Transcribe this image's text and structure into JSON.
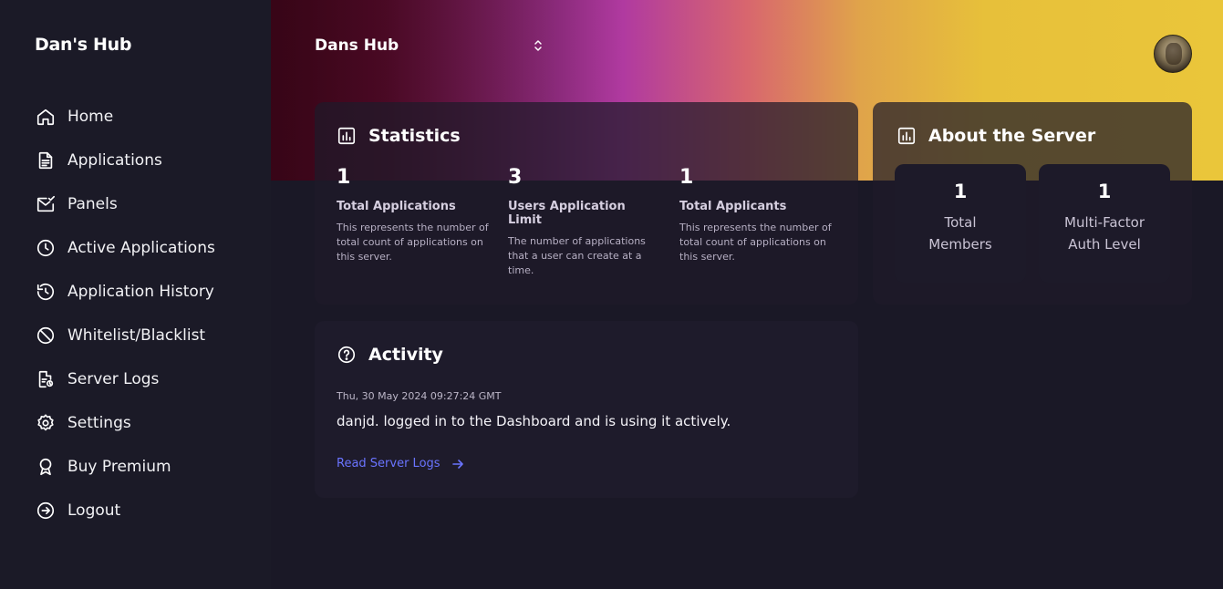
{
  "sidebar": {
    "brand": "Dan's Hub",
    "items": [
      {
        "label": "Home",
        "icon": "home-icon"
      },
      {
        "label": "Applications",
        "icon": "document-icon"
      },
      {
        "label": "Panels",
        "icon": "mail-check-icon"
      },
      {
        "label": "Active Applications",
        "icon": "clock-icon"
      },
      {
        "label": "Application History",
        "icon": "history-icon"
      },
      {
        "label": "Whitelist/Blacklist",
        "icon": "block-icon"
      },
      {
        "label": "Server Logs",
        "icon": "log-file-icon"
      },
      {
        "label": "Settings",
        "icon": "gear-icon"
      },
      {
        "label": "Buy Premium",
        "icon": "badge-icon"
      },
      {
        "label": "Logout",
        "icon": "logout-icon"
      }
    ]
  },
  "header": {
    "server_name": "Dans Hub",
    "switch_icon": "chevron-up-down-icon"
  },
  "statistics": {
    "title": "Statistics",
    "stats": [
      {
        "value": "1",
        "label": "Total Applications",
        "desc": "This represents the number of total count of applications on this server."
      },
      {
        "value": "3",
        "label": "Users Application Limit",
        "desc": "The number of applications that a user can create at a time."
      },
      {
        "value": "1",
        "label": "Total Applicants",
        "desc": "This represents the number of total count of applications on this server."
      }
    ]
  },
  "about": {
    "title": "About the Server",
    "cards": [
      {
        "value": "1",
        "label_line1": "Total",
        "label_line2": "Members"
      },
      {
        "value": "1",
        "label_line1": "Multi-Factor",
        "label_line2": "Auth Level"
      }
    ]
  },
  "activity": {
    "title": "Activity",
    "timestamp": "Thu, 30 May 2024 09:27:24 GMT",
    "message": "danjd. logged in to the Dashboard and is using it actively.",
    "link_label": "Read Server Logs"
  },
  "colors": {
    "background": "#1a1826",
    "sidebar": "#1b1a27",
    "link": "#6a74ff"
  }
}
